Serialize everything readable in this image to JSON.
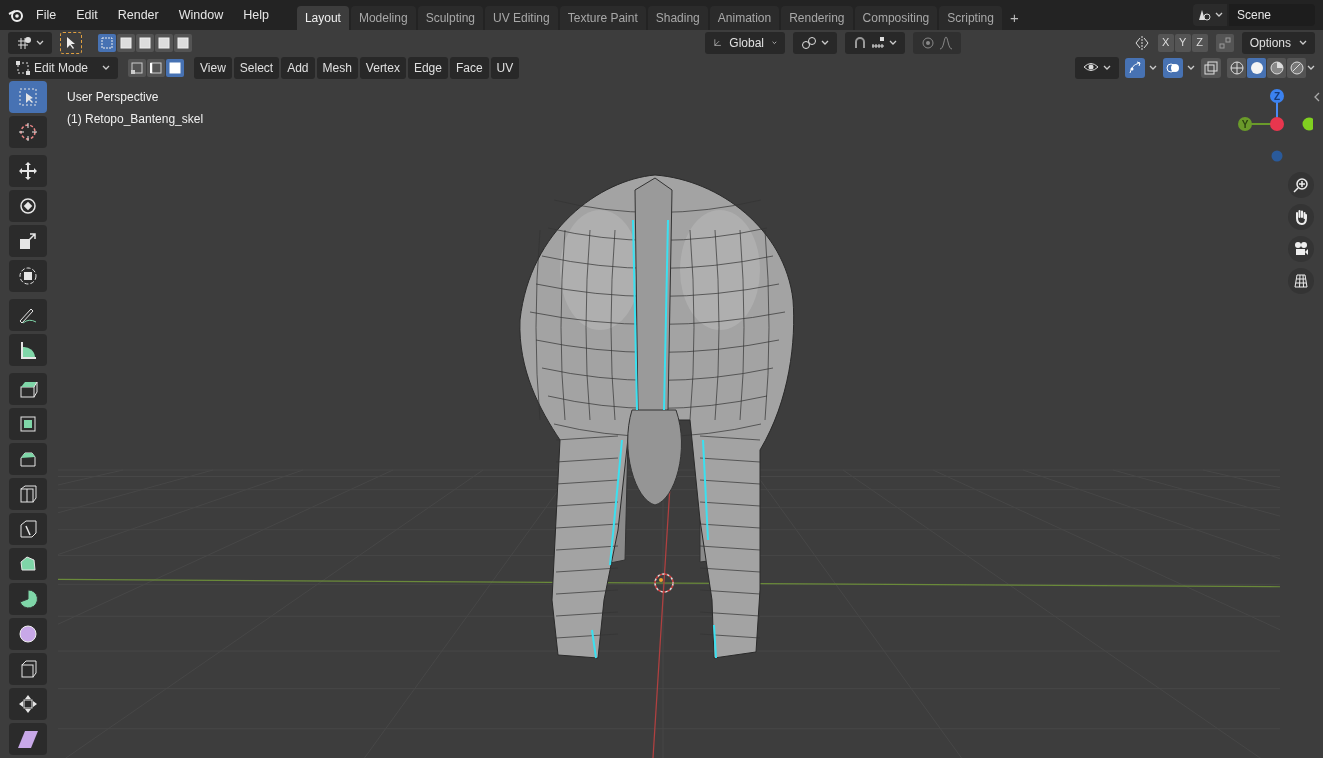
{
  "menu": [
    "File",
    "Edit",
    "Render",
    "Window",
    "Help"
  ],
  "workspaces": [
    {
      "label": "Layout",
      "selected": true
    },
    {
      "label": "Modeling",
      "selected": false
    },
    {
      "label": "Sculpting",
      "selected": false
    },
    {
      "label": "UV Editing",
      "selected": false
    },
    {
      "label": "Texture Paint",
      "selected": false
    },
    {
      "label": "Shading",
      "selected": false
    },
    {
      "label": "Animation",
      "selected": false
    },
    {
      "label": "Rendering",
      "selected": false
    },
    {
      "label": "Compositing",
      "selected": false
    },
    {
      "label": "Scripting",
      "selected": false
    }
  ],
  "add_workspace": "+",
  "scene": "Scene",
  "orientation": "Global",
  "axes": [
    "X",
    "Y",
    "Z"
  ],
  "options": "Options",
  "mode": "Edit Mode",
  "select_modes": [
    {
      "kind": "vertex",
      "selected": false
    },
    {
      "kind": "edge",
      "selected": false
    },
    {
      "kind": "face",
      "selected": true
    }
  ],
  "header_menus": [
    "View",
    "Select",
    "Add",
    "Mesh",
    "Vertex",
    "Edge",
    "Face",
    "UV"
  ],
  "shading": [
    {
      "kind": "wireframe",
      "selected": false
    },
    {
      "kind": "solid",
      "selected": true
    },
    {
      "kind": "material",
      "selected": false
    },
    {
      "kind": "rendered",
      "selected": false
    }
  ],
  "viewport": {
    "view_name": "User Perspective",
    "object": "(1) Retopo_Banteng_skel"
  },
  "gizmo": {
    "z": "Z",
    "y": "Y"
  },
  "tools": [
    {
      "kind": "select",
      "selected": true
    },
    {
      "kind": "cursor",
      "selected": false
    },
    {
      "kind": "move",
      "selected": false
    },
    {
      "kind": "rotate",
      "selected": false
    },
    {
      "kind": "scale",
      "selected": false
    },
    {
      "kind": "transform",
      "selected": false
    },
    {
      "kind": "annotate",
      "selected": false
    },
    {
      "kind": "measure",
      "selected": false
    },
    {
      "kind": "extrude",
      "selected": false
    },
    {
      "kind": "inset",
      "selected": false
    },
    {
      "kind": "bevel",
      "selected": false
    },
    {
      "kind": "loopcut",
      "selected": false
    },
    {
      "kind": "knife",
      "selected": false
    },
    {
      "kind": "polybuild",
      "selected": false
    },
    {
      "kind": "spin",
      "selected": false
    },
    {
      "kind": "smooth",
      "selected": false
    },
    {
      "kind": "edgeslide",
      "selected": false
    },
    {
      "kind": "shrink",
      "selected": false
    },
    {
      "kind": "shear",
      "selected": false
    }
  ]
}
